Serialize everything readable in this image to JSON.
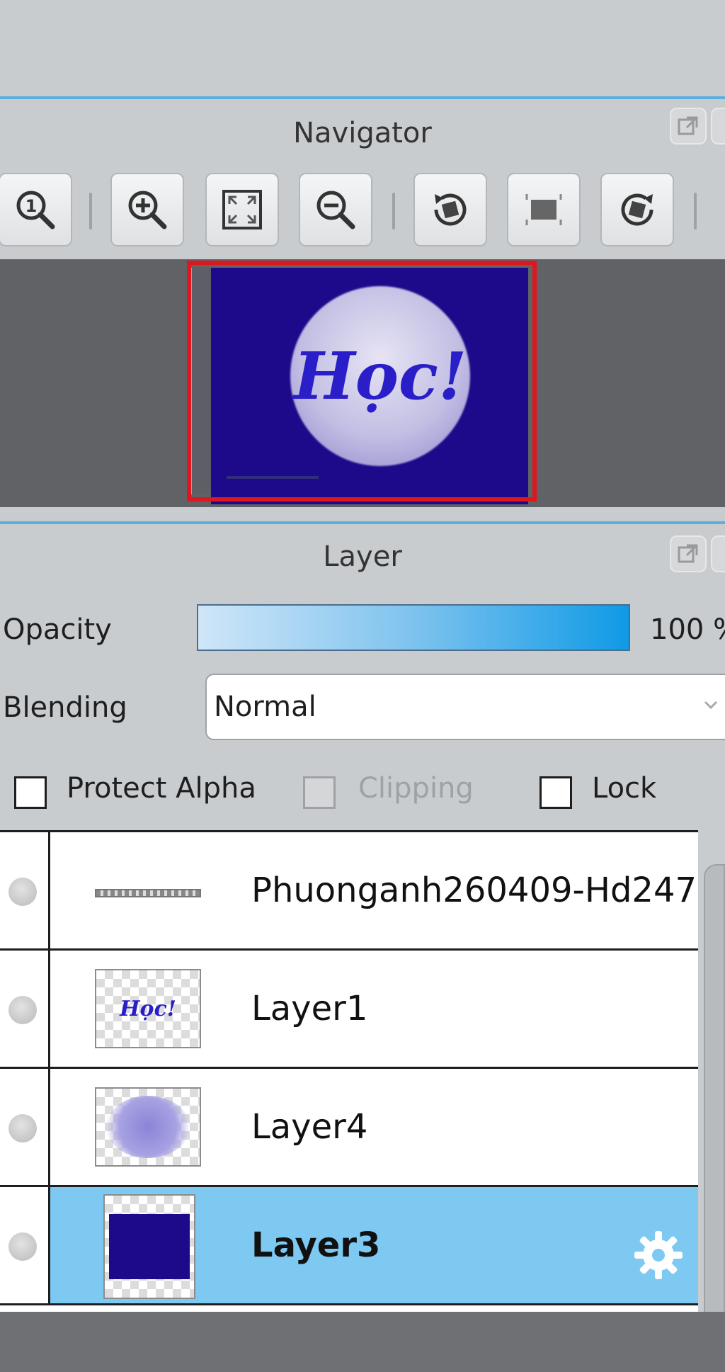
{
  "navigator": {
    "title": "Navigator",
    "toolbar": [
      {
        "icon": "zoom-actual-size-icon"
      },
      {
        "icon": "zoom-in-icon"
      },
      {
        "icon": "fit-to-screen-icon"
      },
      {
        "icon": "zoom-out-icon"
      },
      {
        "icon": "rotate-left-icon"
      },
      {
        "icon": "reset-rotation-icon"
      },
      {
        "icon": "rotate-right-icon"
      }
    ],
    "preview_text": "Học!"
  },
  "layer_panel": {
    "title": "Layer",
    "opacity_label": "Opacity",
    "opacity_value": "100 %",
    "opacity_level": 1.0,
    "blending_label": "Blending",
    "blending_value": "Normal",
    "protect_alpha_label": "Protect Alpha",
    "clipping_label": "Clipping",
    "lock_label": "Lock",
    "layers": [
      {
        "name": "Phuonganh260409-Hd247",
        "selected": false
      },
      {
        "name": "Layer1",
        "selected": false,
        "thumb_text": "Học!"
      },
      {
        "name": "Layer4",
        "selected": false
      },
      {
        "name": "Layer3",
        "selected": true
      }
    ]
  },
  "colors": {
    "accent": "#5aaee0",
    "selection": "#7ec9f2",
    "canvas": "#1c0a8a",
    "viewport_frame": "#e0161e"
  }
}
